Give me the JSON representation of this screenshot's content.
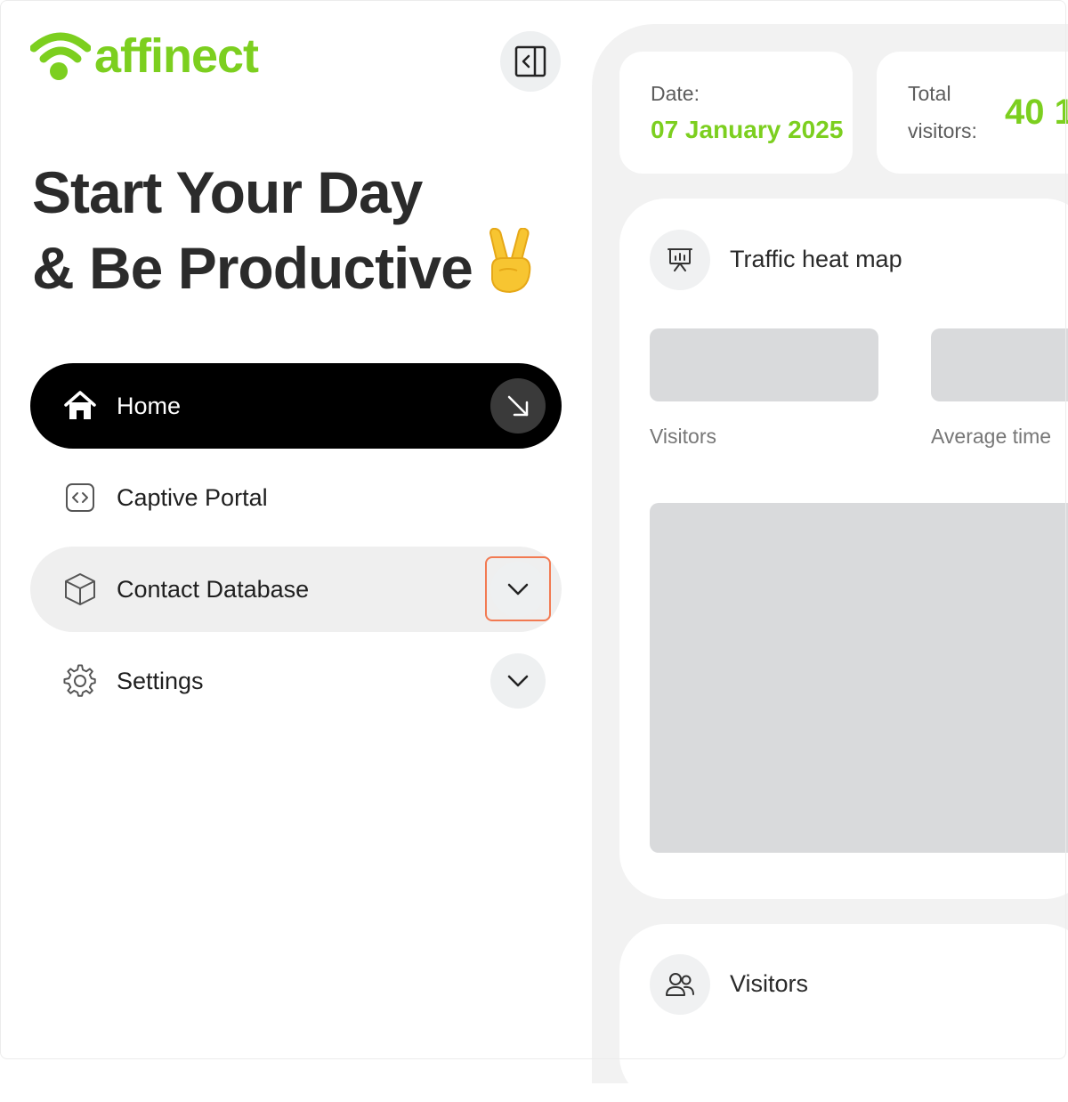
{
  "brand": {
    "name": "affinect",
    "color": "#7ccf1f"
  },
  "headline": {
    "line1": "Start Your Day",
    "line2": "& Be Productive"
  },
  "nav": {
    "home": "Home",
    "captive_portal": "Captive Portal",
    "contact_database": "Contact Database",
    "settings": "Settings"
  },
  "stats": {
    "date_label": "Date:",
    "date_value": "07 January 2025",
    "total_label_1": "Total",
    "total_label_2": "visitors:",
    "total_value": "40 1"
  },
  "heatmap": {
    "title": "Traffic heat map",
    "metric_visitors": "Visitors",
    "metric_average_time": "Average time"
  },
  "visitors_section": {
    "title": "Visitors"
  },
  "icons": {
    "collapse": "sidebar-collapse-icon",
    "home": "home-icon",
    "captive": "code-bracket-icon",
    "contact": "cube-icon",
    "settings": "gear-icon",
    "heatmap": "presentation-chart-icon",
    "visitors": "users-icon"
  },
  "colors": {
    "accent": "#7ccf1f",
    "highlight": "#f27a52",
    "active_nav": "#000000"
  }
}
